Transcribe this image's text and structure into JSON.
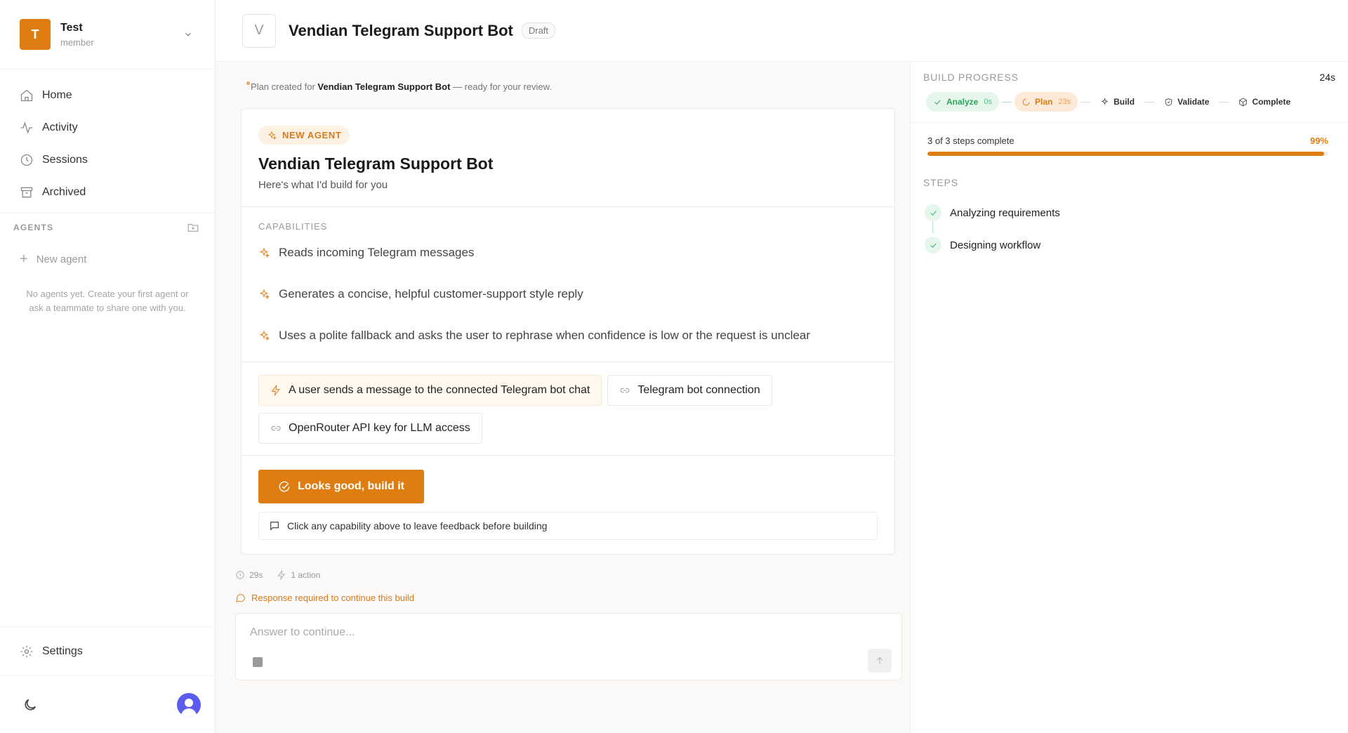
{
  "workspace": {
    "initial": "T",
    "name": "Test",
    "role": "member"
  },
  "nav": [
    {
      "label": "Home",
      "icon": "home-icon"
    },
    {
      "label": "Activity",
      "icon": "activity-icon"
    },
    {
      "label": "Sessions",
      "icon": "clock-icon"
    },
    {
      "label": "Archived",
      "icon": "archive-icon"
    }
  ],
  "agents": {
    "label": "AGENTS",
    "new_agent": "New agent",
    "empty_note": "No agents yet. Create your first agent or ask a teammate to share one with you."
  },
  "settings_label": "Settings",
  "header": {
    "avatar_letter": "V",
    "title": "Vendian Telegram Support Bot",
    "status": "Draft"
  },
  "plan_note": {
    "prefix": "Plan created for",
    "agent": "Vendian Telegram Support Bot",
    "suffix": "— ready for your review."
  },
  "card": {
    "badge": "NEW AGENT",
    "title": "Vendian Telegram Support Bot",
    "subtitle": "Here's what I'd build for you",
    "capabilities_label": "CAPABILITIES",
    "capabilities": [
      "Reads incoming Telegram messages",
      "Generates a concise, helpful customer-support style reply",
      "Uses a polite fallback and asks the user to rephrase when confidence is low or the request is unclear"
    ],
    "trigger": "A user sends a message to the connected Telegram bot chat",
    "connections": [
      "Telegram bot connection",
      "OpenRouter API key for LLM access"
    ],
    "build_button": "Looks good, build it",
    "feedback_hint": "Click any capability above to leave feedback before building"
  },
  "meta": {
    "duration": "29s",
    "actions": "1 action"
  },
  "required_note": "Response required to continue this build",
  "composer": {
    "placeholder": "Answer to continue..."
  },
  "build_progress": {
    "label": "BUILD PROGRESS",
    "elapsed": "24s",
    "stages": [
      {
        "label": "Analyze",
        "time": "0s",
        "state": "done"
      },
      {
        "label": "Plan",
        "time": "23s",
        "state": "active"
      },
      {
        "label": "Build",
        "time": "",
        "state": "pending"
      },
      {
        "label": "Validate",
        "time": "",
        "state": "pending"
      },
      {
        "label": "Complete",
        "time": "",
        "state": "pending"
      }
    ],
    "summary": "3 of 3 steps complete",
    "percent_label": "99%",
    "percent": 99,
    "accent": "#e07d10"
  },
  "steps": {
    "label": "STEPS",
    "items": [
      "Analyzing requirements",
      "Designing workflow"
    ]
  }
}
